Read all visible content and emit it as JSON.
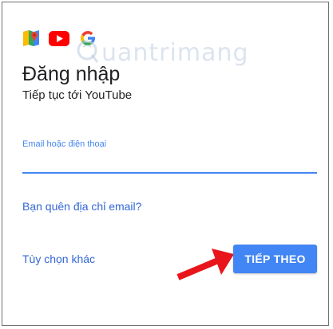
{
  "app_icons": [
    "google-maps-icon",
    "youtube-icon",
    "google-g-icon"
  ],
  "watermark": {
    "text": "uantrimang"
  },
  "page": {
    "title": "Đăng nhập",
    "subtitle": "Tiếp tục tới YouTube"
  },
  "email_field": {
    "label": "Email hoặc điện thoại",
    "value": ""
  },
  "links": {
    "forgot_email": "Bạn quên địa chỉ email?",
    "more_options": "Tùy chọn khác"
  },
  "buttons": {
    "next_label": "TIẾP THEO"
  },
  "colors": {
    "accent": "#4285f4",
    "link": "#3367d6",
    "annotation_arrow": "#e8161b",
    "youtube_red": "#ff0000"
  }
}
